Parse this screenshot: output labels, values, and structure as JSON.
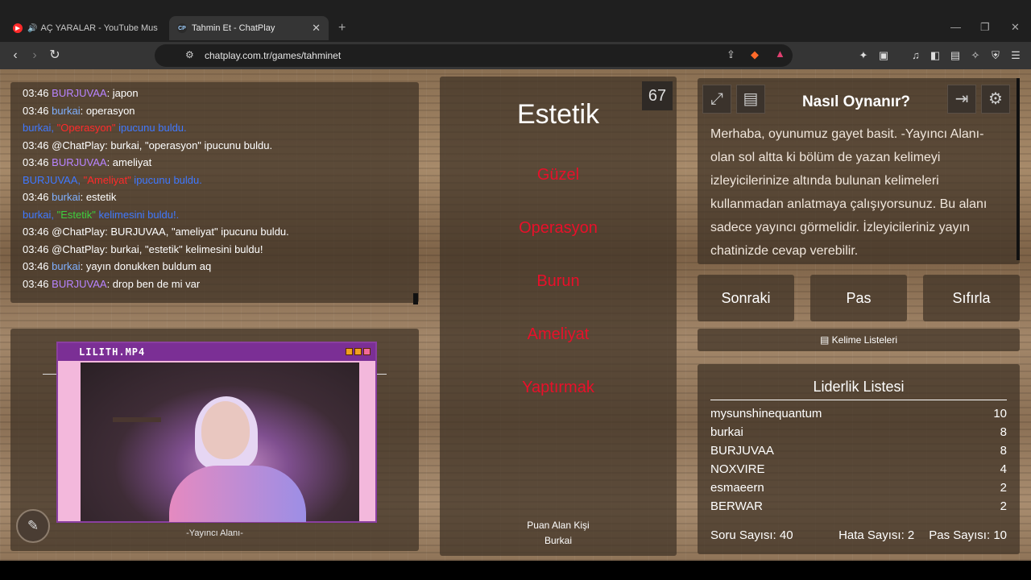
{
  "browser": {
    "tabs": [
      {
        "title": "AÇ YARALAR - YouTube Music",
        "favicon": "youtube-music-icon",
        "active": false
      },
      {
        "title": "Tahmin Et - ChatPlay",
        "favicon": "cp",
        "active": true
      }
    ],
    "url": "chatplay.com.tr/games/tahminet"
  },
  "chat": {
    "lines": [
      {
        "time": "03:46",
        "user": "BURJUVAA",
        "user_color": "purple",
        "msg": ": japon"
      },
      {
        "time": "03:46",
        "user": "burkai",
        "user_color": "blue",
        "msg": ": operasyon"
      },
      {
        "type": "hint",
        "pre": "burkai, ",
        "word": "\"Operasyon\"",
        "post": " ipucunu buldu."
      },
      {
        "time": "03:46",
        "text": "@ChatPlay: burkai, \"operasyon\" ipucunu buldu."
      },
      {
        "time": "03:46",
        "user": "BURJUVAA",
        "user_color": "purple",
        "msg": ": ameliyat"
      },
      {
        "type": "hint",
        "pre": "BURJUVAA, ",
        "word": "\"Ameliyat\"",
        "post": " ipucunu buldu."
      },
      {
        "time": "03:46",
        "user": "burkai",
        "user_color": "blue",
        "msg": ": estetik"
      },
      {
        "type": "found",
        "pre": "burkai, ",
        "word": "\"Estetik\"",
        "post": " kelimesini buldu!."
      },
      {
        "time": "03:46",
        "text": "@ChatPlay: BURJUVAA, \"ameliyat\" ipucunu buldu."
      },
      {
        "time": "03:46",
        "text": "@ChatPlay: burkai, \"estetik\" kelimesini buldu!"
      },
      {
        "time": "03:46",
        "user": "burkai",
        "user_color": "blue",
        "msg": ": yayın donukken buldum aq"
      },
      {
        "time": "03:46",
        "user": "BURJUVAA",
        "user_color": "purple",
        "msg": ": drop ben de mi var"
      }
    ]
  },
  "streamer": {
    "window_title": "LILITH.MP4",
    "label": "-Yayıncı Alanı-"
  },
  "game": {
    "timer": "67",
    "main_word": "Estetik",
    "taboo_words": [
      "Güzel",
      "Operasyon",
      "Burun",
      "Ameliyat",
      "Yaptırmak"
    ],
    "scorer_label": "Puan Alan Kişi",
    "scorer_name": "Burkai"
  },
  "howto": {
    "title": "Nasıl Oynanır?",
    "body": "Merhaba, oyunumuz gayet basit. -Yayıncı Alanı- olan sol altta ki bölüm de yazan kelimeyi izleyicilerinize altında bulunan kelimeleri kullanmadan anlatmaya çalışıyorsunuz. Bu alanı sadece yayıncı görmelidir. İzleyicileriniz yayın chatinizde cevap verebilir."
  },
  "actions": {
    "next": "Sonraki",
    "pass": "Pas",
    "reset": "Sıfırla",
    "word_lists": "Kelime Listeleri"
  },
  "leaderboard": {
    "title": "Liderlik Listesi",
    "rows": [
      {
        "name": "mysunshinequantum",
        "score": "10"
      },
      {
        "name": "burkai",
        "score": "8"
      },
      {
        "name": "BURJUVAA",
        "score": "8"
      },
      {
        "name": "NOXVIRE",
        "score": "4"
      },
      {
        "name": "esmaeern",
        "score": "2"
      },
      {
        "name": "BERWAR",
        "score": "2"
      }
    ],
    "question_count": "Soru Sayısı: 40",
    "error_count": "Hata Sayısı: 2",
    "pass_count": "Pas Sayısı: 10"
  },
  "colors": {
    "taboo": "#e8102a",
    "user_purple": "#b884ff",
    "user_blue": "#7fb0ff",
    "system_blue": "#3f78ff"
  }
}
